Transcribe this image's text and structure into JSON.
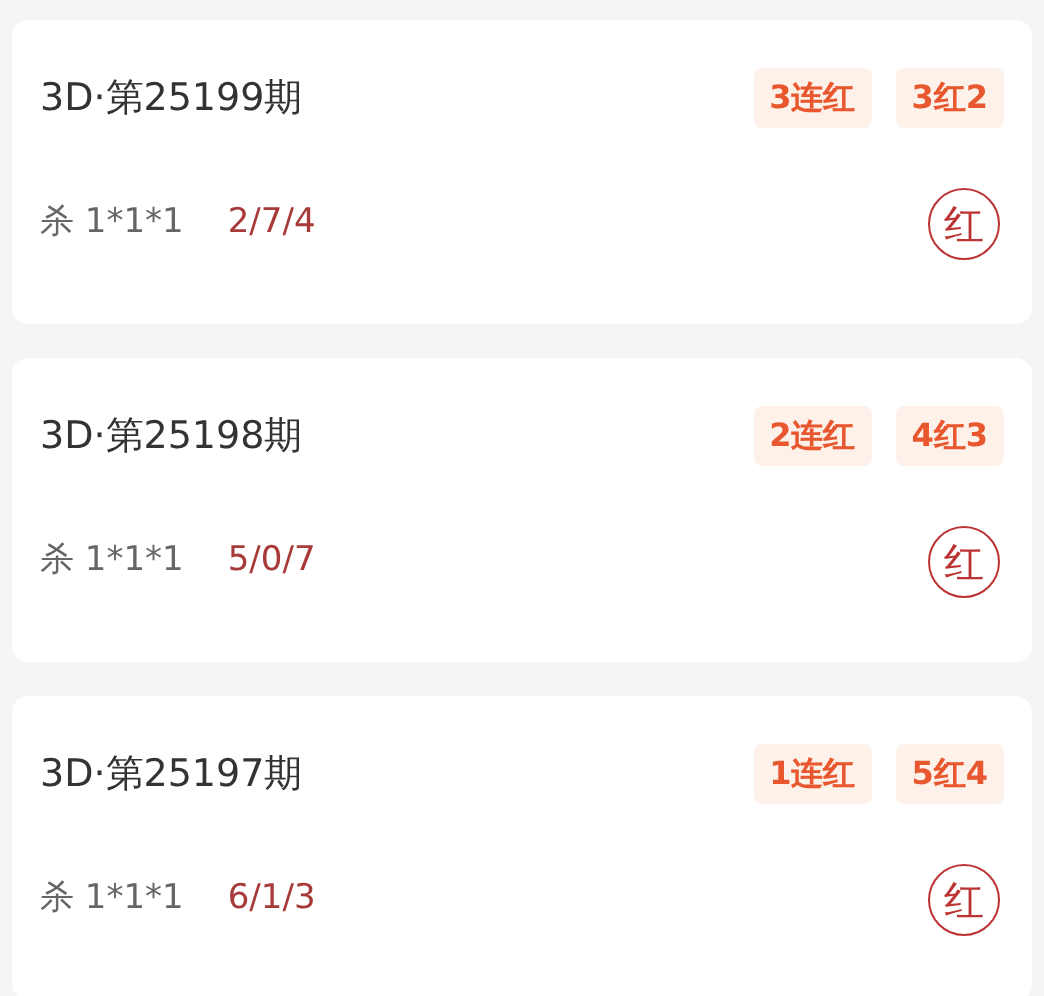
{
  "records": [
    {
      "title": "3D·第25199期",
      "tags": [
        "3连红",
        "3红2"
      ],
      "kill": "杀 1*1*1",
      "numbers": "2/7/4",
      "stamp": "红"
    },
    {
      "title": "3D·第25198期",
      "tags": [
        "2连红",
        "4红3"
      ],
      "kill": "杀 1*1*1",
      "numbers": "5/0/7",
      "stamp": "红"
    },
    {
      "title": "3D·第25197期",
      "tags": [
        "1连红",
        "5红4"
      ],
      "kill": "杀 1*1*1",
      "numbers": "6/1/3",
      "stamp": "红"
    }
  ]
}
